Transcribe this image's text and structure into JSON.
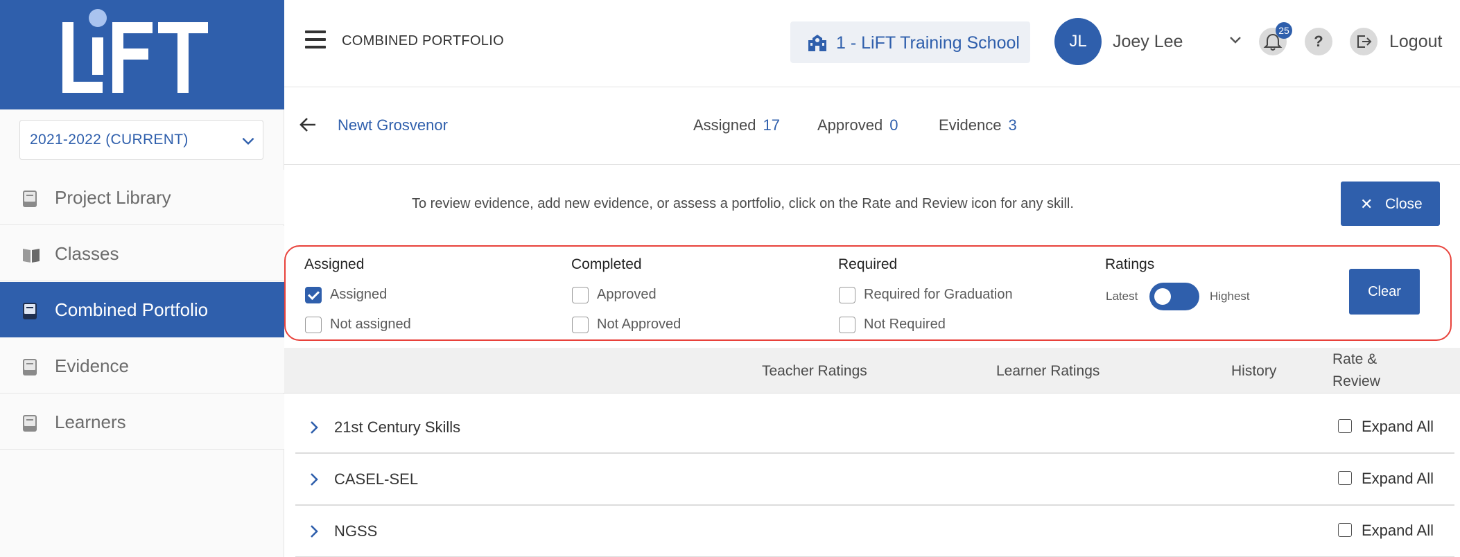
{
  "brand": {
    "logo_text": "LiFT",
    "color": "#2f5fac"
  },
  "sidebar": {
    "year_select": {
      "value": "2021-2022 (CURRENT)"
    },
    "items": [
      {
        "label": "Project Library",
        "icon": "book-icon",
        "active": false
      },
      {
        "label": "Classes",
        "icon": "open-book-icon",
        "active": false
      },
      {
        "label": "Combined Portfolio",
        "icon": "portfolio-icon",
        "active": true
      },
      {
        "label": "Evidence",
        "icon": "book-icon",
        "active": false
      },
      {
        "label": "Learners",
        "icon": "book-icon",
        "active": false
      }
    ]
  },
  "header": {
    "menu_icon": "hamburger-icon",
    "title": "COMBINED PORTFOLIO",
    "school": "1 - LiFT Training School",
    "user": {
      "initials": "JL",
      "name": "Joey Lee"
    },
    "notifications_count": "25",
    "help_label": "?",
    "logout_label": "Logout"
  },
  "learner": {
    "name": "Newt Grosvenor",
    "stats": [
      {
        "label": "Assigned",
        "value": "17"
      },
      {
        "label": "Approved",
        "value": "0"
      },
      {
        "label": "Evidence",
        "value": "3"
      }
    ]
  },
  "info": {
    "text": "To review evidence, add new evidence, or assess a portfolio, click on the Rate and Review icon for any skill.",
    "close_label": "Close"
  },
  "filters": {
    "groups": [
      {
        "title": "Assigned",
        "options": [
          {
            "label": "Assigned",
            "checked": true
          },
          {
            "label": "Not assigned",
            "checked": false
          }
        ]
      },
      {
        "title": "Completed",
        "options": [
          {
            "label": "Approved",
            "checked": false
          },
          {
            "label": "Not Approved",
            "checked": false
          }
        ]
      },
      {
        "title": "Required",
        "options": [
          {
            "label": "Required for Graduation",
            "checked": false
          },
          {
            "label": "Not Required",
            "checked": false
          }
        ]
      }
    ],
    "ratings": {
      "title": "Ratings",
      "left_label": "Latest",
      "right_label": "Highest",
      "toggle_on": false
    },
    "clear_label": "Clear"
  },
  "table": {
    "columns": [
      "Teacher Ratings",
      "Learner Ratings",
      "History",
      "Rate &",
      "Review"
    ],
    "rows": [
      {
        "name": "21st Century Skills",
        "expand_label": "Expand All"
      },
      {
        "name": "CASEL-SEL",
        "expand_label": "Expand All"
      },
      {
        "name": "NGSS",
        "expand_label": "Expand All"
      }
    ]
  }
}
